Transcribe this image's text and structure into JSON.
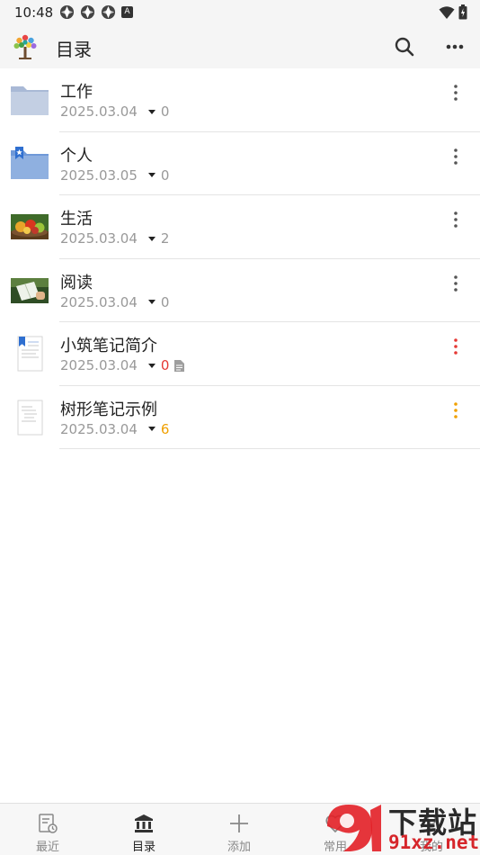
{
  "status_bar": {
    "time": "10:48",
    "left_icons": [
      "app-notification-icon",
      "app-notification-icon",
      "app-notification-icon",
      "a-badge-icon"
    ],
    "a_badge": "A",
    "right_icons": [
      "wifi-icon",
      "battery-icon"
    ]
  },
  "app_bar": {
    "title": "目录",
    "logo_icon": "tree-logo-icon",
    "actions": [
      "search-icon",
      "more-horizontal-icon"
    ]
  },
  "list": {
    "items": [
      {
        "title": "工作",
        "date": "2025.03.04",
        "count": "0",
        "count_color": "#999999",
        "icon": "folder-icon",
        "menu_color": "#555555"
      },
      {
        "title": "个人",
        "date": "2025.03.05",
        "count": "0",
        "count_color": "#999999",
        "icon": "bookmark-folder-icon",
        "menu_color": "#555555"
      },
      {
        "title": "生活",
        "date": "2025.03.04",
        "count": "2",
        "count_color": "#999999",
        "icon": "fruit-photo-icon",
        "menu_color": "#555555"
      },
      {
        "title": "阅读",
        "date": "2025.03.04",
        "count": "0",
        "count_color": "#999999",
        "icon": "reading-photo-icon",
        "menu_color": "#555555"
      },
      {
        "title": "小筑笔记简介",
        "date": "2025.03.04",
        "count": "0",
        "count_color": "#e53935",
        "icon": "bookmark-document-icon",
        "menu_color": "#e53935",
        "has_doc_icon": true
      },
      {
        "title": "树形笔记示例",
        "date": "2025.03.04",
        "count": "6",
        "count_color": "#f0a000",
        "icon": "document-icon",
        "menu_color": "#f0a000"
      }
    ]
  },
  "bottom_nav": {
    "items": [
      {
        "label": "最近",
        "icon": "recent-note-icon"
      },
      {
        "label": "目录",
        "icon": "library-icon",
        "active": true
      },
      {
        "label": "添加",
        "icon": "add-icon"
      },
      {
        "label": "常用",
        "icon": "heart-icon"
      },
      {
        "label": "我的",
        "icon": "profile-icon"
      }
    ]
  },
  "watermark": {
    "line1": "下载站",
    "line2": "91xz.net"
  },
  "colors": {
    "accent_red": "#e53935",
    "accent_orange": "#f0a000",
    "folder_blue": "#8fb0e0"
  }
}
